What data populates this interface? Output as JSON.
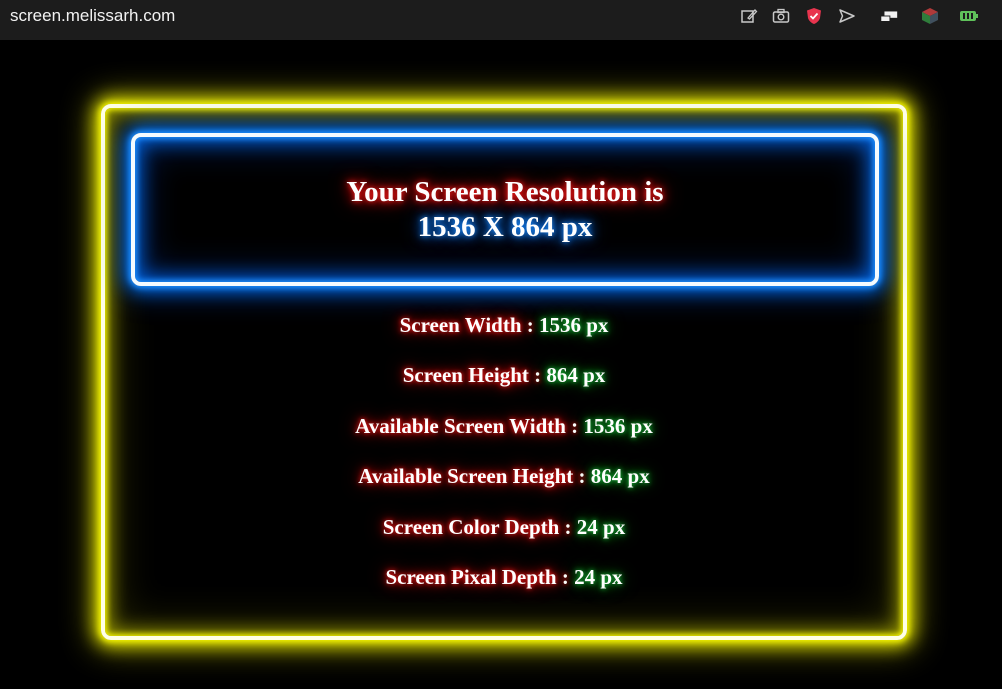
{
  "browser": {
    "url": "screen.melissarh.com",
    "icons": [
      "edit-icon",
      "camera-icon",
      "shield-icon",
      "send-icon",
      "cast-icon",
      "cube-icon",
      "battery-icon"
    ]
  },
  "headline": {
    "line1": "Your Screen Resolution is",
    "line2": "1536 X 864 px"
  },
  "info": [
    {
      "label": "Screen Width :",
      "value": "1536 px"
    },
    {
      "label": "Screen Height :",
      "value": "864 px"
    },
    {
      "label": "Available Screen Width :",
      "value": "1536 px"
    },
    {
      "label": "Available Screen Height :",
      "value": "864 px"
    },
    {
      "label": "Screen Color Depth :",
      "value": "24 px"
    },
    {
      "label": "Screen Pixal Depth :",
      "value": "24 px"
    }
  ],
  "colors": {
    "outer_glow": "#f3f300",
    "inner_glow": "#1e90ff",
    "label_glow": "#ff2020",
    "value_glow": "#20c040"
  }
}
